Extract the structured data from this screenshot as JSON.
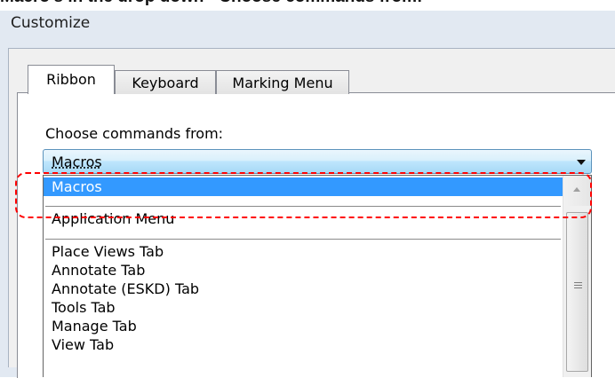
{
  "caption": "Macro's in the drop down - Choose commands from:",
  "window": {
    "title": "Customize"
  },
  "tabs": [
    {
      "label": "Ribbon",
      "active": true
    },
    {
      "label": "Keyboard",
      "active": false
    },
    {
      "label": "Marking Menu",
      "active": false
    }
  ],
  "commands_label": "Choose commands from:",
  "combo": {
    "value": "Macros"
  },
  "dropdown": {
    "items": [
      "Macros",
      "Application Menu",
      "Place Views Tab",
      "Annotate Tab",
      "Annotate (ESKD) Tab",
      "Tools Tab",
      "Manage Tab",
      "View Tab"
    ],
    "selected": "Macros"
  },
  "colors": {
    "selection": "#3399ff",
    "annotation": "#ff0000",
    "combo_border": "#5c93bc"
  },
  "icons": [
    "chevron-down-icon",
    "scroll-up-arrow-icon",
    "scroll-grip-icon"
  ]
}
